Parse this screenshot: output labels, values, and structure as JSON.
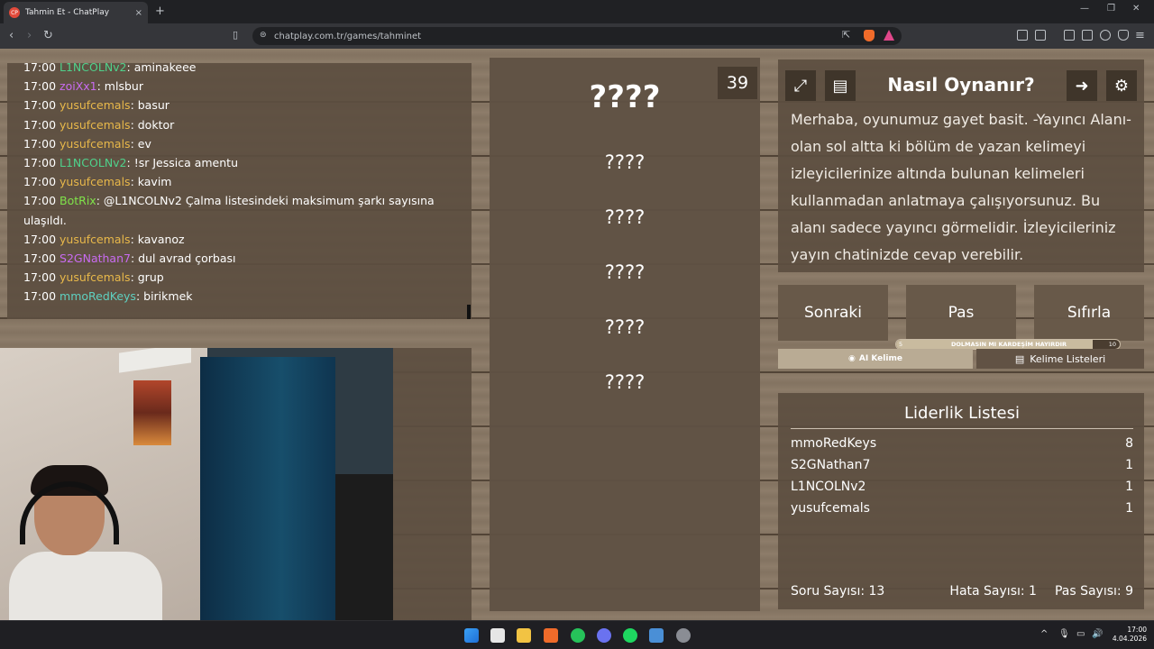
{
  "browser": {
    "tab_title": "Tahmin Et - ChatPlay",
    "tab_favicon": "CP",
    "tab_close": "×",
    "new_tab": "+",
    "url": "chatplay.com.tr/games/tahminet",
    "window_minimize": "—",
    "window_restore": "❐",
    "window_close": "✕"
  },
  "chat": {
    "messages": [
      {
        "time": "17:00",
        "user": "L1NCOLNv2",
        "color": "#4fd18b",
        "text": ": aminakeee"
      },
      {
        "time": "17:00",
        "user": "zoiXx1",
        "color": "#c86bf0",
        "text": ": mlsbur"
      },
      {
        "time": "17:00",
        "user": "yusufcemals",
        "color": "#e8b84a",
        "text": ": basur"
      },
      {
        "time": "17:00",
        "user": "yusufcemals",
        "color": "#e8b84a",
        "text": ": doktor"
      },
      {
        "time": "17:00",
        "user": "yusufcemals",
        "color": "#e8b84a",
        "text": ": ev"
      },
      {
        "time": "17:00",
        "user": "L1NCOLNv2",
        "color": "#4fd18b",
        "text": ": !sr Jessica amentu"
      },
      {
        "time": "17:00",
        "user": "yusufcemals",
        "color": "#e8b84a",
        "text": ": kavim"
      },
      {
        "time": "17:00",
        "user": "BotRix",
        "color": "#7fe34a",
        "text": ": @L1NCOLNv2 Çalma listesindeki maksimum şarkı sayısına ulaşıldı."
      },
      {
        "time": "17:00",
        "user": "yusufcemals",
        "color": "#e8b84a",
        "text": ": kavanoz"
      },
      {
        "time": "17:00",
        "user": "S2GNathan7",
        "color": "#c86bf0",
        "text": ": dul avrad çorbası"
      },
      {
        "time": "17:00",
        "user": "yusufcemals",
        "color": "#e8b84a",
        "text": ": grup"
      },
      {
        "time": "17:00",
        "user": "mmoRedKeys",
        "color": "#5fd0c0",
        "text": ": birikmek"
      }
    ]
  },
  "game": {
    "counter": "39",
    "main_word": "????",
    "forbidden_words": [
      "????",
      "????",
      "????",
      "????",
      "????"
    ]
  },
  "how_to": {
    "title": "Nasıl Oynanır?",
    "text": "Merhaba, oyunumuz gayet basit. -Yayıncı Alanı- olan sol altta ki bölüm de yazan kelimeyi izleyicilerinize altında bulunan kelimeleri kullanmadan anlatmaya çalışıyorsunuz. Bu alanı sadece yayıncı görmelidir. İzleyicileriniz yayın chatinizde cevap verebilir.",
    "icons": [
      "expand-icon",
      "document-icon",
      "exit-icon",
      "gear-icon"
    ]
  },
  "controls": {
    "next": "Sonraki",
    "pass": "Pas",
    "reset": "Sıfırla",
    "progress_text": "DOLMASIN MI KARDEŞİM HAYIRDIR",
    "progress_min": "5",
    "progress_max": "10",
    "progress_value": 0.88,
    "ai_word": "AI Kelime",
    "word_lists": "Kelime Listeleri"
  },
  "leaderboard": {
    "title": "Liderlik Listesi",
    "rows": [
      {
        "name": "mmoRedKeys",
        "score": "8"
      },
      {
        "name": "S2GNathan7",
        "score": "1"
      },
      {
        "name": "L1NCOLNv2",
        "score": "1"
      },
      {
        "name": "yusufcemals",
        "score": "1"
      }
    ],
    "question_count": "Soru Sayısı: 13",
    "error_count": "Hata Sayısı: 1",
    "pass_count": "Pas Sayısı: 9"
  },
  "taskbar": {
    "time": "17:00",
    "date": "4.04.2026"
  }
}
